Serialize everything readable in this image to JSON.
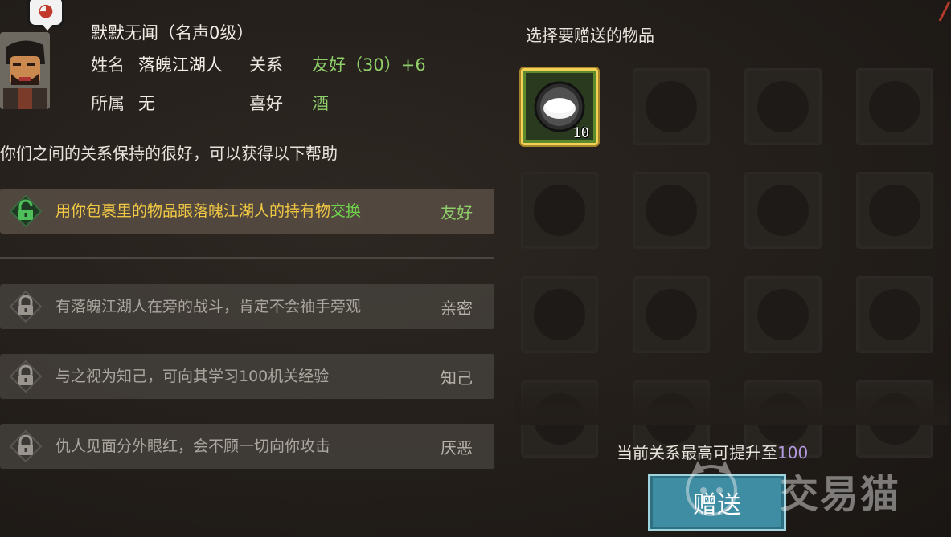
{
  "npc": {
    "name_line": "默默无闻（名声0级）",
    "name_label": "姓名",
    "name_value": "落魄江湖人",
    "relation_label": "关系",
    "relation_value": "友好（30）+6",
    "faction_label": "所属",
    "faction_value": "无",
    "likes_label": "喜好",
    "likes_value": "酒"
  },
  "intro_text": "你们之间的关系保持的很好，可以获得以下帮助",
  "benefits": [
    {
      "text_main": "用你包裹里的物品跟落魄江湖人的持有物",
      "text_hl": "交换",
      "level": "友好",
      "unlocked": true
    },
    {
      "text_main": "有落魄江湖人在旁的战斗，肯定不会袖手旁观",
      "level": "亲密",
      "unlocked": false
    },
    {
      "text_main": "与之视为知己，可向其学习100机关经验",
      "level": "知己",
      "unlocked": false
    },
    {
      "text_main": "仇人见面分外眼红，会不顾一切向你攻击",
      "level": "厌恶",
      "unlocked": false
    }
  ],
  "gift_panel": {
    "title": "选择要赠送的物品",
    "items": [
      {
        "name": "wine-bowl-icon",
        "count": "10",
        "selected": true
      }
    ],
    "max_relation_label": "当前关系最高可提升至",
    "max_relation_value": "100",
    "give_button": "赠送"
  },
  "watermark": {
    "text": "交易猫"
  },
  "colors": {
    "unlocked_text": "#f0c844",
    "highlight_green": "#6fd44a",
    "level_green": "#8fcf6a",
    "locked_text": "#aaa59e",
    "selected_border": "#f1d256",
    "button_teal": "#3f8da3",
    "number_purple": "#b39ae0"
  }
}
